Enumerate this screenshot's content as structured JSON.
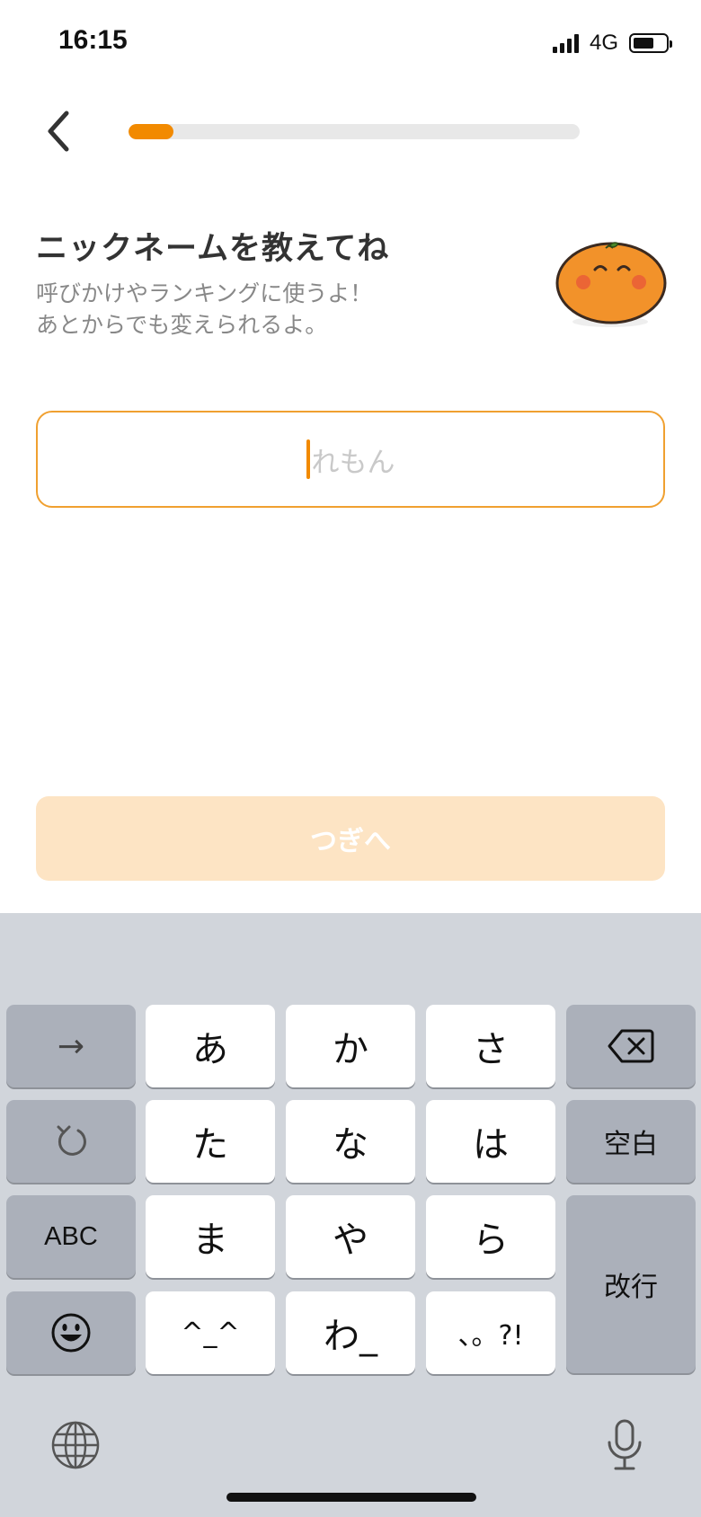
{
  "status": {
    "time": "16:15",
    "network": "4G"
  },
  "progress": {
    "value": 0.1
  },
  "heading": {
    "title": "ニックネームを教えてね",
    "subtitle_line1": "呼びかけやランキングに使うよ！",
    "subtitle_line2": "あとからでも変えられるよ。"
  },
  "nickname": {
    "value": "",
    "placeholder": "れもん"
  },
  "next_button": {
    "label": "つぎへ"
  },
  "keyboard": {
    "row1": [
      "→",
      "あ",
      "か",
      "さ"
    ],
    "row2": [
      "た",
      "な",
      "は",
      "空白"
    ],
    "row3": [
      "ABC",
      "ま",
      "や",
      "ら",
      "改行"
    ],
    "row4": [
      "^_^",
      "わ_",
      "、。?!"
    ]
  },
  "colors": {
    "accent": "#f28a00",
    "button_disabled": "#fde4c4",
    "keyboard_bg": "#d1d5db"
  }
}
